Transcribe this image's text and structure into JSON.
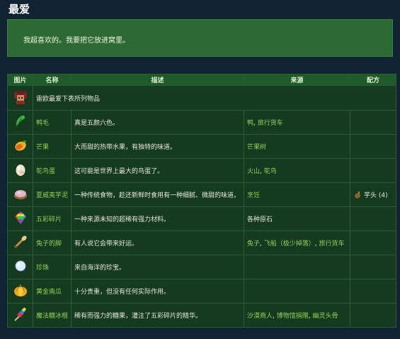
{
  "page": {
    "title": "最爱",
    "quote": "我超喜欢的。我要把它放进窝里。"
  },
  "table": {
    "headers": [
      "图片",
      "名称",
      "描述",
      "来源",
      "配方"
    ],
    "all_items_text": "雷欧最爱下表所列物品",
    "rows": [
      {
        "icon": "duck-feather-icon",
        "name": "鸭毛",
        "description": "真是五颜六色。",
        "source_links": [
          "鸭",
          "旅行货车"
        ],
        "source_plain": "",
        "recipe": ""
      },
      {
        "icon": "mango-icon",
        "name": "芒果",
        "description": "大而甜的热带水果，有独特的味道。",
        "source_links": [
          "芒果树"
        ],
        "source_plain": "",
        "recipe": ""
      },
      {
        "icon": "ostrich-egg-icon",
        "name": "鸵鸟蛋",
        "description": "这可能是世界上最大的鸟蛋了。",
        "source_links": [
          "火山",
          "鸵鸟"
        ],
        "source_plain": "",
        "recipe": ""
      },
      {
        "icon": "poi-icon",
        "name": "夏威夷芋泥",
        "description": "一种传统食物，趁还新鲜时食用有一种细腻、微甜的味道。",
        "source_links": [
          "烹饪"
        ],
        "source_plain": "",
        "recipe": "芋头 (4)"
      },
      {
        "icon": "prismatic-shard-icon",
        "name": "五彩碎片",
        "description": "一种来源未知的超稀有强力材料。",
        "source_links": [],
        "source_plain": "各种原石",
        "recipe": ""
      },
      {
        "icon": "rabbits-foot-icon",
        "name": "兔子的脚",
        "description": "有人说它会带来好运。",
        "source_links": [
          "兔子",
          "飞船（极少掉落）",
          "旅行货车"
        ],
        "source_plain": "",
        "recipe": ""
      },
      {
        "icon": "pearl-icon",
        "name": "珍珠",
        "description": "来自海洋的珍宝。",
        "source_links": [],
        "source_plain": "",
        "recipe": ""
      },
      {
        "icon": "golden-pumpkin-icon",
        "name": "黄金南瓜",
        "description": "十分贵重，但没有任何实际作用。",
        "source_links": [],
        "source_plain": "",
        "recipe": ""
      },
      {
        "icon": "magic-rock-candy-icon",
        "name": "魔法糖冰棍",
        "description": "稀有而强力的糖果，灌注了五彩碎片的精华。",
        "source_links": [
          "沙漠商人",
          "博物馆捐赠",
          "幽灵头骨"
        ],
        "source_plain": "",
        "recipe": ""
      }
    ]
  },
  "colors": {
    "link": "#8fcf5a",
    "header_bg": "#1f5a2a",
    "quote_bg": "#2d6a33",
    "page_bg": "#0f2430"
  }
}
